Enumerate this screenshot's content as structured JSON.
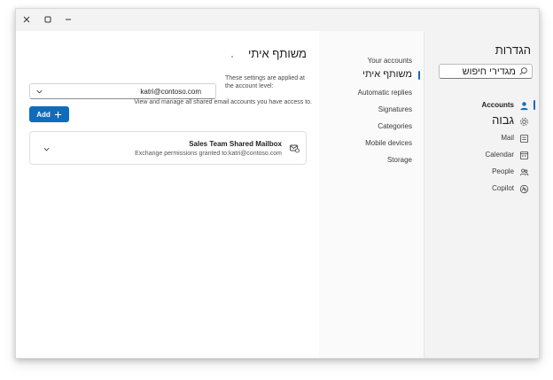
{
  "window": {
    "controls": {
      "close": "close-icon",
      "maximize": "maximize-icon",
      "minimize": "minimize-icon"
    }
  },
  "nav": {
    "title": "הגדרות",
    "search": {
      "placeholder": "מגדירי חיפוש",
      "value": ""
    },
    "items": [
      {
        "label": "Accounts",
        "icon": "person-icon",
        "selected": true
      },
      {
        "label": "גבוה",
        "icon": "gear-icon",
        "selected": false
      },
      {
        "label": "Mail",
        "icon": "mail-icon",
        "selected": false
      },
      {
        "label": "Calendar",
        "icon": "calendar-icon",
        "selected": false
      },
      {
        "label": "People",
        "icon": "people-icon",
        "selected": false
      },
      {
        "label": "Copilot",
        "icon": "copilot-icon",
        "selected": false
      }
    ]
  },
  "subnav": {
    "items": [
      {
        "label": "Your accounts",
        "selected": false
      },
      {
        "label": "משותף איתי",
        "selected": true
      },
      {
        "label": "Automatic replies",
        "selected": false
      },
      {
        "label": "Signatures",
        "selected": false
      },
      {
        "label": "Categories",
        "selected": false
      },
      {
        "label": "Mobile devices",
        "selected": false
      },
      {
        "label": "Storage",
        "selected": false
      }
    ]
  },
  "main": {
    "title": "משותף איתי",
    "note_account": "These settings are applied at the account level:",
    "account_value": "katri@contoso.com",
    "note_shared": "View and manage all shared email accounts you have access to.",
    "add_label": "Add",
    "mailbox": {
      "name": "Sales Team Shared Mailbox",
      "detail": "Exchange permissions granted to:katri@contoso.com"
    }
  },
  "colors": {
    "accent": "#0f6cbd",
    "nav_bg": "#f3f3f3",
    "subnav_bg": "#fafafa"
  }
}
